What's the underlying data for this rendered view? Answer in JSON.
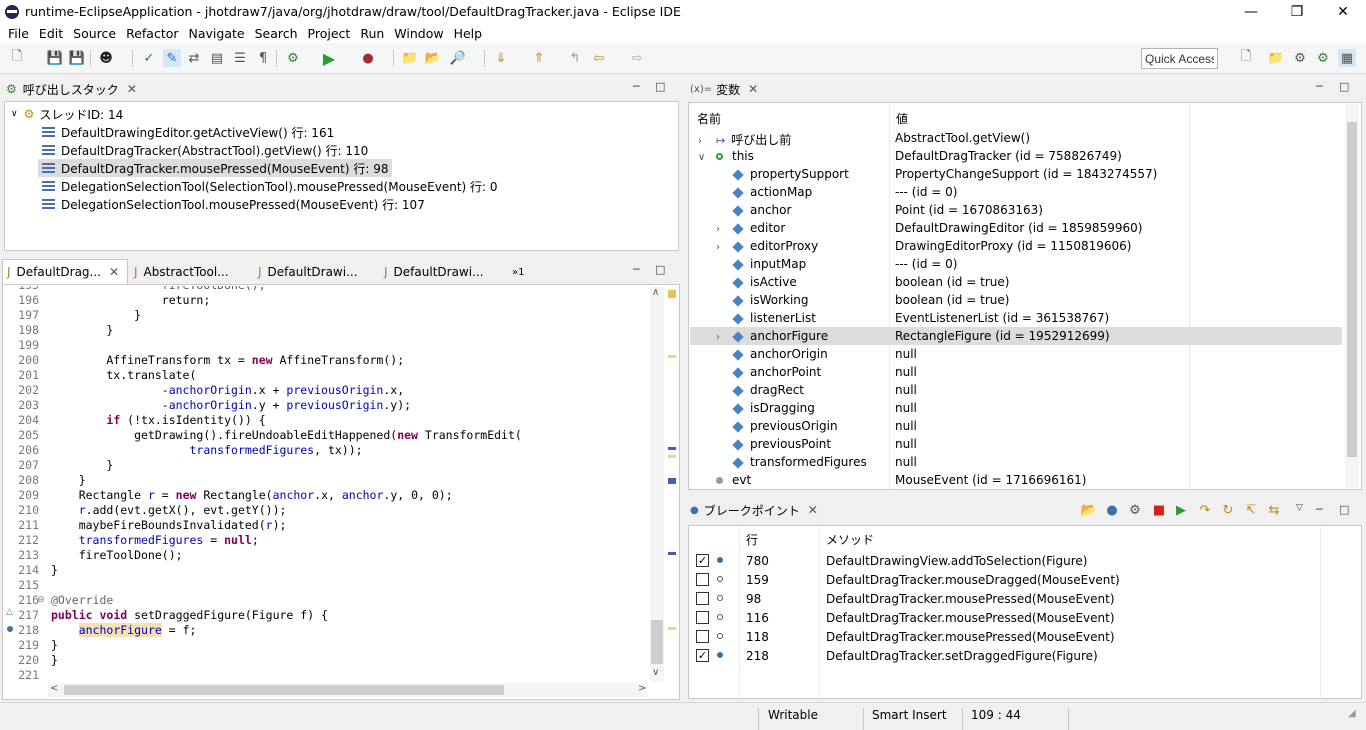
{
  "window": {
    "title": "runtime-EclipseApplication - jhotdraw7/java/org/jhotdraw/draw/tool/DefaultDragTracker.java - Eclipse IDE"
  },
  "menu": [
    "File",
    "Edit",
    "Source",
    "Refactor",
    "Navigate",
    "Search",
    "Project",
    "Run",
    "Window",
    "Help"
  ],
  "quick_access": "Quick Access",
  "debug_view": {
    "tab": "呼び出しスタック",
    "thread": "スレッドID: 14",
    "frames": [
      "DefaultDrawingEditor.getActiveView() 行: 161",
      "DefaultDragTracker(AbstractTool).getView() 行: 110",
      "DefaultDragTracker.mousePressed(MouseEvent) 行: 98",
      "DelegationSelectionTool(SelectionTool).mousePressed(MouseEvent) 行: 0",
      "DelegationSelectionTool.mousePressed(MouseEvent) 行: 107"
    ]
  },
  "editor": {
    "tabs": [
      "DefaultDrag...",
      "AbstractTool...",
      "DefaultDrawi...",
      "DefaultDrawi..."
    ],
    "overflow": "»1",
    "lines": [
      {
        "n": "196",
        "segs": [
          [
            "",
            "                return;"
          ]
        ]
      },
      {
        "n": "197",
        "segs": [
          [
            "",
            "            }"
          ]
        ]
      },
      {
        "n": "198",
        "segs": [
          [
            "",
            "        }"
          ]
        ]
      },
      {
        "n": "199",
        "segs": [
          [
            "",
            ""
          ]
        ]
      },
      {
        "n": "200",
        "segs": [
          [
            "",
            "        AffineTransform tx = "
          ],
          [
            "kw",
            "new"
          ],
          [
            "",
            " AffineTransform();"
          ]
        ]
      },
      {
        "n": "201",
        "segs": [
          [
            "",
            "        tx.translate("
          ]
        ]
      },
      {
        "n": "202",
        "segs": [
          [
            "",
            "                -"
          ],
          [
            "fld",
            "anchorOrigin"
          ],
          [
            "",
            ".x + "
          ],
          [
            "fld",
            "previousOrigin"
          ],
          [
            "",
            ".x,"
          ]
        ]
      },
      {
        "n": "203",
        "segs": [
          [
            "",
            "                -"
          ],
          [
            "fld",
            "anchorOrigin"
          ],
          [
            "",
            ".y + "
          ],
          [
            "fld",
            "previousOrigin"
          ],
          [
            "",
            ".y);"
          ]
        ]
      },
      {
        "n": "204",
        "segs": [
          [
            "",
            "        "
          ],
          [
            "kw",
            "if"
          ],
          [
            "",
            " (!tx.isIdentity()) {"
          ]
        ]
      },
      {
        "n": "205",
        "segs": [
          [
            "",
            "            getDrawing().fireUndoableEditHappened("
          ],
          [
            "kw",
            "new"
          ],
          [
            "",
            " TransformEdit("
          ]
        ]
      },
      {
        "n": "206",
        "segs": [
          [
            "",
            "                    "
          ],
          [
            "fld",
            "transformedFigures"
          ],
          [
            "",
            ", tx));"
          ]
        ]
      },
      {
        "n": "207",
        "segs": [
          [
            "",
            "        }"
          ]
        ]
      },
      {
        "n": "208",
        "segs": [
          [
            "",
            "    }"
          ]
        ]
      },
      {
        "n": "209",
        "segs": [
          [
            "",
            "    Rectangle "
          ],
          [
            "fld",
            "r"
          ],
          [
            "",
            " = "
          ],
          [
            "kw",
            "new"
          ],
          [
            "",
            " Rectangle("
          ],
          [
            "fld",
            "anchor"
          ],
          [
            "",
            ".x, "
          ],
          [
            "fld",
            "anchor"
          ],
          [
            "",
            ".y, 0, 0);"
          ]
        ]
      },
      {
        "n": "210",
        "segs": [
          [
            "",
            "    "
          ],
          [
            "fld",
            "r"
          ],
          [
            "",
            ".add(evt.getX(), evt.getY());"
          ]
        ]
      },
      {
        "n": "211",
        "segs": [
          [
            "",
            "    maybeFireBoundsInvalidated("
          ],
          [
            "fld",
            "r"
          ],
          [
            "",
            ");"
          ]
        ]
      },
      {
        "n": "212",
        "segs": [
          [
            "",
            "    "
          ],
          [
            "fld",
            "transformedFigures"
          ],
          [
            "",
            " = "
          ],
          [
            "kw",
            "null"
          ],
          [
            "",
            ";"
          ]
        ]
      },
      {
        "n": "213",
        "segs": [
          [
            "",
            "    fireToolDone();"
          ]
        ]
      },
      {
        "n": "214",
        "segs": [
          [
            "",
            "}"
          ]
        ]
      },
      {
        "n": "215",
        "segs": [
          [
            "",
            ""
          ]
        ]
      },
      {
        "n": "216",
        "segs": [
          [
            "ann",
            "@Override"
          ]
        ]
      },
      {
        "n": "217",
        "segs": [
          [
            "kw",
            "public"
          ],
          [
            "",
            " "
          ],
          [
            "kw",
            "void"
          ],
          [
            "",
            " setDraggedFigure(Figure f) {"
          ]
        ]
      },
      {
        "n": "218",
        "segs": [
          [
            "",
            "    "
          ],
          [
            "fld hl",
            "anchorFigure"
          ],
          [
            "",
            " = f;"
          ]
        ]
      },
      {
        "n": "219",
        "segs": [
          [
            "",
            "}"
          ]
        ]
      },
      {
        "n": "220",
        "segs": [
          [
            "",
            "}"
          ]
        ]
      },
      {
        "n": "221",
        "segs": [
          [
            "",
            ""
          ]
        ]
      }
    ]
  },
  "variables": {
    "tab": "変数",
    "col_name": "名前",
    "col_value": "値",
    "rows": [
      {
        "name": "呼び出し前",
        "value": "AbstractTool.getView()"
      },
      {
        "name": "this",
        "value": "DefaultDragTracker (id = 758826749)"
      },
      {
        "name": "propertySupport",
        "value": "PropertyChangeSupport (id = 1843274557)"
      },
      {
        "name": "actionMap",
        "value": "--- (id = 0)"
      },
      {
        "name": "anchor",
        "value": "Point (id = 1670863163)"
      },
      {
        "name": "editor",
        "value": "DefaultDrawingEditor (id = 1859859960)"
      },
      {
        "name": "editorProxy",
        "value": "DrawingEditorProxy (id = 1150819606)"
      },
      {
        "name": "inputMap",
        "value": "--- (id = 0)"
      },
      {
        "name": "isActive",
        "value": "boolean (id = true)"
      },
      {
        "name": "isWorking",
        "value": "boolean (id = true)"
      },
      {
        "name": "listenerList",
        "value": "EventListenerList (id = 361538767)"
      },
      {
        "name": "anchorFigure",
        "value": "RectangleFigure (id = 1952912699)"
      },
      {
        "name": "anchorOrigin",
        "value": "null"
      },
      {
        "name": "anchorPoint",
        "value": "null"
      },
      {
        "name": "dragRect",
        "value": "null"
      },
      {
        "name": "isDragging",
        "value": "null"
      },
      {
        "name": "previousOrigin",
        "value": "null"
      },
      {
        "name": "previousPoint",
        "value": "null"
      },
      {
        "name": "transformedFigures",
        "value": "null"
      },
      {
        "name": "evt",
        "value": "MouseEvent (id = 1716696161)"
      }
    ]
  },
  "breakpoints": {
    "tab": "ブレークポイント",
    "col_line": "行",
    "col_method": "メソッド",
    "rows": [
      {
        "checked": "✓",
        "line": "780",
        "method": "DefaultDrawingView.addToSelection(Figure)"
      },
      {
        "checked": "",
        "line": "159",
        "method": "DefaultDragTracker.mouseDragged(MouseEvent)"
      },
      {
        "checked": "",
        "line": "98",
        "method": "DefaultDragTracker.mousePressed(MouseEvent)"
      },
      {
        "checked": "",
        "line": "116",
        "method": "DefaultDragTracker.mousePressed(MouseEvent)"
      },
      {
        "checked": "",
        "line": "118",
        "method": "DefaultDragTracker.mousePressed(MouseEvent)"
      },
      {
        "checked": "✓",
        "line": "218",
        "method": "DefaultDragTracker.setDraggedFigure(Figure)"
      }
    ]
  },
  "status": {
    "writable": "Writable",
    "insert": "Smart Insert",
    "position": "109 : 44"
  }
}
